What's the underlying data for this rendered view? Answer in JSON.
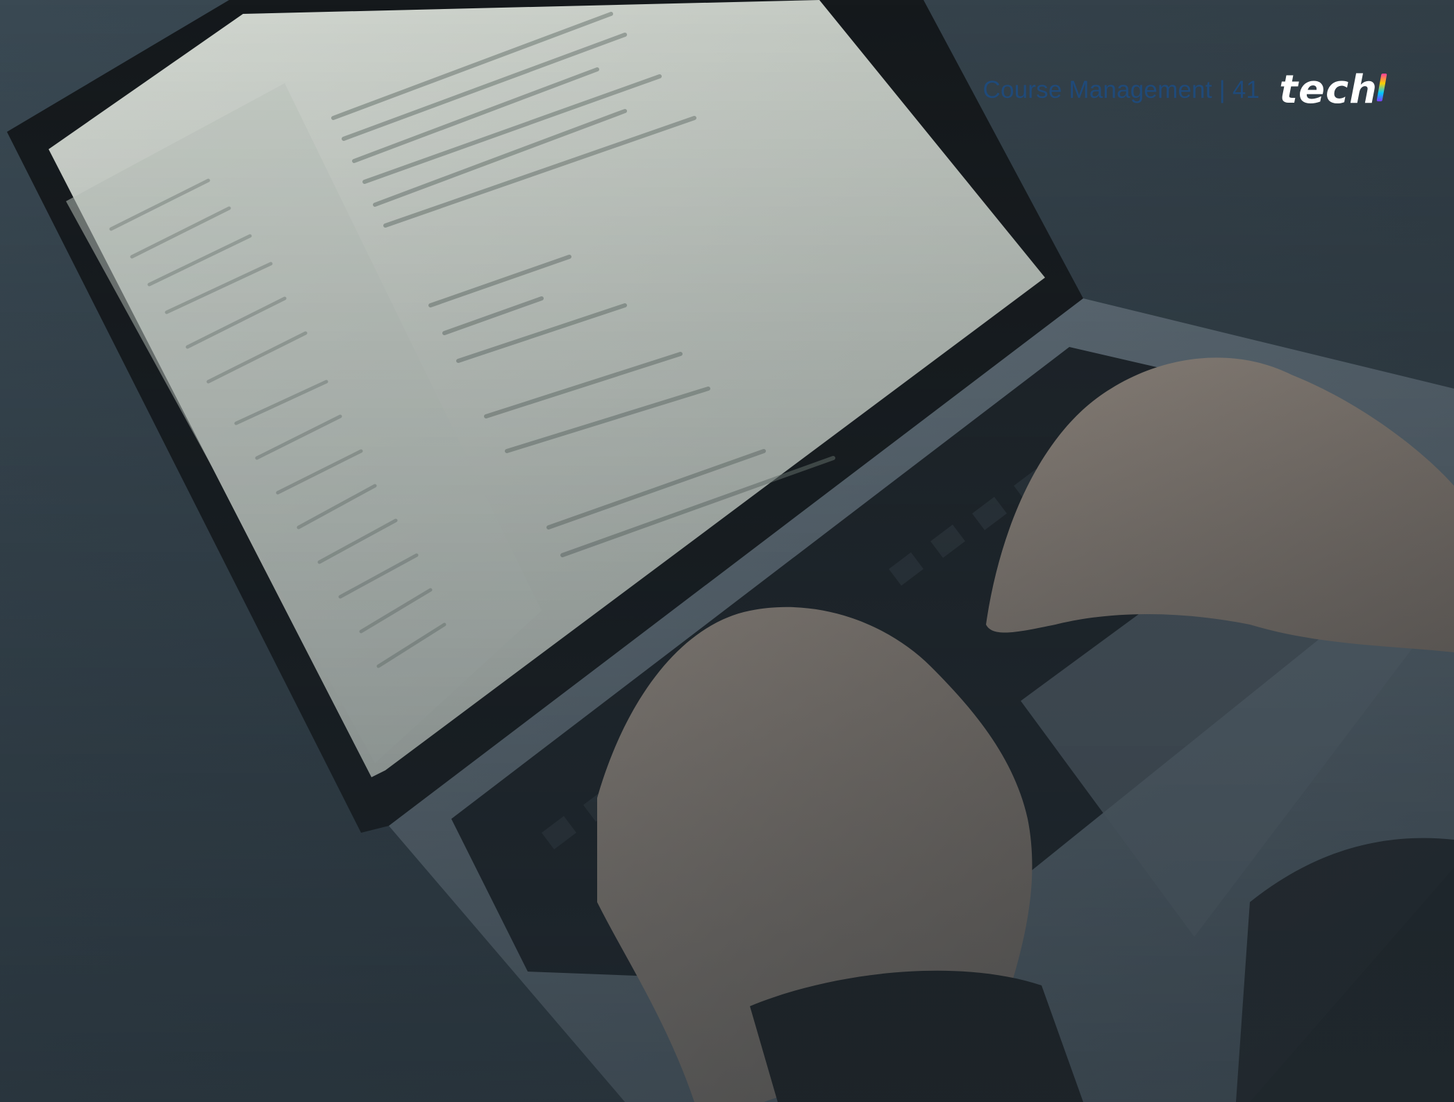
{
  "header": {
    "running_head": "Course Management | 41",
    "logo_text": "tech"
  },
  "photo": {
    "subject": "laptop-with-code-editor-and-typing-hands",
    "colors": {
      "background": "#34414a",
      "screen": "#c9cfc8",
      "laptop_body": "#5a6670",
      "keyboard": "#1c2227",
      "hands": "#8a7f76",
      "sleeve": "#1b1e21",
      "accent_text": "#1f4a7a"
    }
  }
}
